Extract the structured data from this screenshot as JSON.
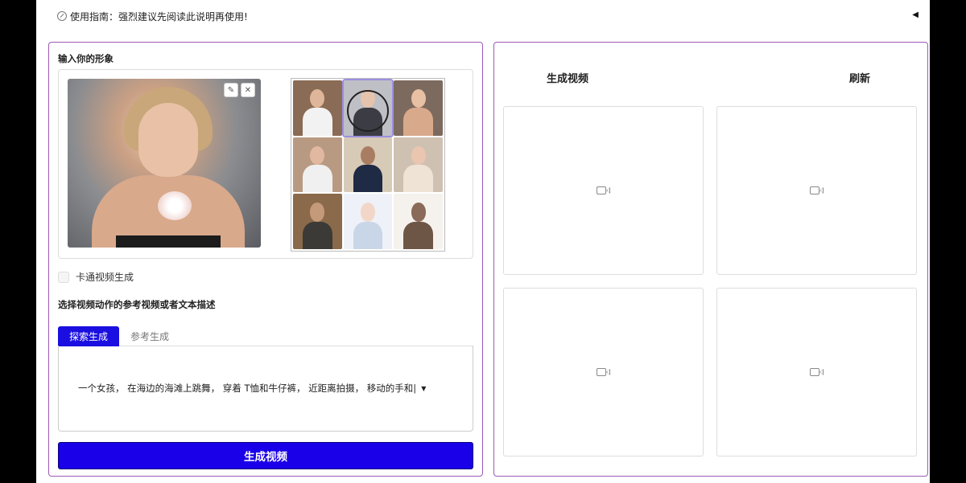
{
  "guide": {
    "text": "使用指南：强烈建议先阅读此说明再使用!",
    "collapse_icon": "◀"
  },
  "left_panel": {
    "input_label": "输入你的形象",
    "image_edit_icon": "✎",
    "image_close_icon": "✕",
    "gallery": {
      "thumbs": [
        {
          "name": "woman-white-tee",
          "bg": "#8a6b55",
          "head": "#e0b69a",
          "torso": "#f2f2f2"
        },
        {
          "name": "woman-portrait-selected",
          "bg": "#bfbfc6",
          "head": "#e6c3ad",
          "torso": "#3c3c44"
        },
        {
          "name": "woman-blonde",
          "bg": "#7d6a5e",
          "head": "#e8c0a3",
          "torso": "#d9a98b"
        },
        {
          "name": "woman-hand-face",
          "bg": "#b89a82",
          "head": "#e2b8a0",
          "torso": "#f0f0f0"
        },
        {
          "name": "man-jacket",
          "bg": "#d7cbb7",
          "head": "#a97d62",
          "torso": "#1f2a44"
        },
        {
          "name": "woman-sweater",
          "bg": "#cfc1b2",
          "head": "#eac6b0",
          "torso": "#efe3d6"
        },
        {
          "name": "man-dark-coat",
          "bg": "#8a6a4a",
          "head": "#c49a7a",
          "torso": "#3b3a36"
        },
        {
          "name": "anime-figure",
          "bg": "#eef2f8",
          "head": "#f2d7c8",
          "torso": "#c9d6e8"
        },
        {
          "name": "statue-figure",
          "bg": "#f5f2ee",
          "head": "#8a6a58",
          "torso": "#6e5646"
        }
      ]
    },
    "checkbox_label": "卡通视频生成",
    "reference_label": "选择视频动作的参考视频或者文本描述",
    "tabs": [
      {
        "label": "探索生成",
        "active": true
      },
      {
        "label": "参考生成",
        "active": false
      }
    ],
    "prompt_text": "一个女孩， 在海边的海滩上跳舞， 穿着 T恤和牛仔裤， 近距离拍摄， 移动的手和|",
    "prompt_caret": "▼",
    "generate_button": "生成视频"
  },
  "right_panel": {
    "title_left": "生成视频",
    "title_right": "刷新",
    "video_icon": "video-camera-icon",
    "video_slots": 4
  },
  "colors": {
    "accent": "#1a00e8",
    "panel_border": "#9b59b6",
    "active_tab": "#1a0fe0"
  }
}
